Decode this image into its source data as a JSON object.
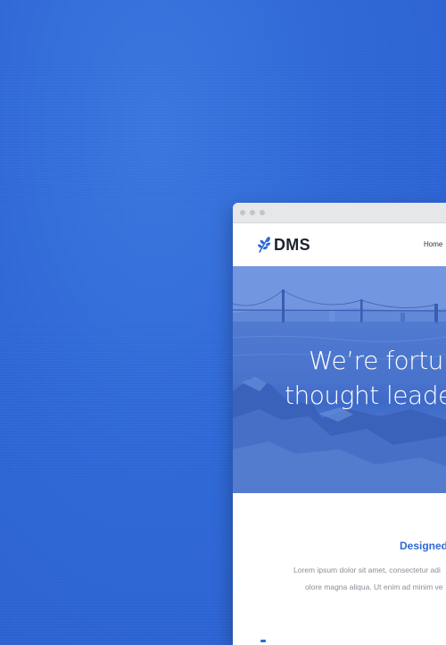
{
  "site": {
    "logo_text": "DMS",
    "nav": {
      "home_label": "Home"
    }
  },
  "hero": {
    "line1": "We’re fortun",
    "line2": "thought leade"
  },
  "section": {
    "title": "Designed",
    "paragraph_line1": "Lorem ipsum dolor sit amet, consectetur adi",
    "paragraph_line2": "olore magna aliqua. Ut enim ad minim ve"
  },
  "colors": {
    "background": "#2f69d8",
    "accent": "#2f68d6",
    "logo_text": "#1d2230"
  },
  "icons": {
    "logo": "leaf-sprig-icon",
    "window_buttons": [
      "window-dot-icon",
      "window-dot-icon",
      "window-dot-icon"
    ]
  }
}
